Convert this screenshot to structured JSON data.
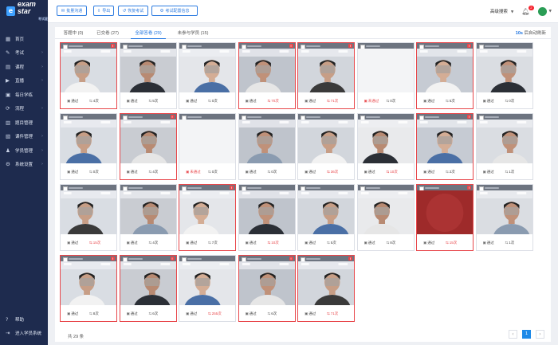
{
  "app": {
    "logo_text": "exam star",
    "logo_sub": "考试星"
  },
  "sidebar": {
    "items": [
      {
        "label": "首页",
        "icon": "grid-icon",
        "glyph": "▦",
        "chevron": false
      },
      {
        "label": "考试",
        "icon": "exam-icon",
        "glyph": "✎",
        "chevron": true
      },
      {
        "label": "课程",
        "icon": "course-icon",
        "glyph": "▤",
        "chevron": true
      },
      {
        "label": "直播",
        "icon": "live-icon",
        "glyph": "▶",
        "chevron": true
      },
      {
        "label": "每日学练",
        "icon": "calendar-icon",
        "glyph": "▣",
        "chevron": false
      },
      {
        "label": "流程",
        "icon": "flow-icon",
        "glyph": "⟳",
        "chevron": true
      },
      {
        "label": "题目管理",
        "icon": "question-icon",
        "glyph": "▥",
        "chevron": false
      },
      {
        "label": "课件管理",
        "icon": "courseware-icon",
        "glyph": "▧",
        "chevron": true
      },
      {
        "label": "学员管理",
        "icon": "student-icon",
        "glyph": "♟",
        "chevron": true
      },
      {
        "label": "系统设置",
        "icon": "gear-icon",
        "glyph": "⚙",
        "chevron": true
      }
    ],
    "bottom": [
      {
        "label": "帮助",
        "icon": "help-icon",
        "glyph": "?"
      },
      {
        "label": "进入学员系统",
        "icon": "enter-icon",
        "glyph": "⇥"
      }
    ]
  },
  "toolbar": {
    "buttons": [
      {
        "label": "批量沟通",
        "glyph": "✉",
        "name": "batch-message-button"
      },
      {
        "label": "导出",
        "glyph": "⇩",
        "name": "export-button"
      },
      {
        "label": "恢复考试",
        "glyph": "↺",
        "name": "resume-exam-button"
      },
      {
        "label": "考试配置信息",
        "glyph": "⚙",
        "name": "exam-config-button"
      }
    ]
  },
  "header": {
    "search_select": "高级搜索",
    "notif_count": "2"
  },
  "tabs": [
    {
      "label": "答题中 (0)",
      "active": false
    },
    {
      "label": "已交卷 (27)",
      "active": false
    },
    {
      "label": "全部答卷 (29)",
      "active": true
    },
    {
      "label": "未参与学员 (15)",
      "active": false
    }
  ],
  "refresh": {
    "seconds": "10s",
    "label": "后自动刷新"
  },
  "cards": [
    {
      "flag": true,
      "status": "通过",
      "count": "4次",
      "red": false,
      "cred": false
    },
    {
      "flag": false,
      "status": "通过",
      "count": "5次",
      "red": false,
      "cred": false
    },
    {
      "flag": false,
      "status": "通过",
      "count": "0次",
      "red": false,
      "cred": false
    },
    {
      "flag": true,
      "status": "通过",
      "count": "70次",
      "red": false,
      "cred": true
    },
    {
      "flag": true,
      "status": "通过",
      "count": "71次",
      "red": false,
      "cred": true
    },
    {
      "flag": false,
      "status": "未通过",
      "count": "0次",
      "red": true,
      "cred": false
    },
    {
      "flag": true,
      "status": "通过",
      "count": "5次",
      "red": false,
      "cred": false
    },
    {
      "flag": false,
      "status": "通过",
      "count": "0次",
      "red": false,
      "cred": false
    },
    {
      "flag": false,
      "status": "通过",
      "count": "0次",
      "red": false,
      "cred": false
    },
    {
      "flag": true,
      "status": "通过",
      "count": "4次",
      "red": false,
      "cred": false
    },
    {
      "flag": false,
      "status": "未通过",
      "count": "0次",
      "red": true,
      "cred": false
    },
    {
      "flag": false,
      "status": "通过",
      "count": "0次",
      "red": false,
      "cred": false
    },
    {
      "flag": false,
      "status": "通过",
      "count": "36次",
      "red": false,
      "cred": true
    },
    {
      "flag": false,
      "status": "通过",
      "count": "10次",
      "red": false,
      "cred": true
    },
    {
      "flag": true,
      "status": "通过",
      "count": "2次",
      "red": false,
      "cred": false
    },
    {
      "flag": false,
      "status": "通过",
      "count": "1次",
      "red": false,
      "cred": false
    },
    {
      "flag": false,
      "status": "通过",
      "count": "15次",
      "red": false,
      "cred": true
    },
    {
      "flag": false,
      "status": "通过",
      "count": "4次",
      "red": false,
      "cred": false
    },
    {
      "flag": true,
      "status": "通过",
      "count": "7次",
      "red": false,
      "cred": false
    },
    {
      "flag": false,
      "status": "通过",
      "count": "10次",
      "red": false,
      "cred": true
    },
    {
      "flag": false,
      "status": "通过",
      "count": "5次",
      "red": false,
      "cred": false
    },
    {
      "flag": false,
      "status": "通过",
      "count": "8次",
      "red": false,
      "cred": false
    },
    {
      "flag": true,
      "status": "通过",
      "count": "15次",
      "red": false,
      "cred": true
    },
    {
      "flag": false,
      "status": "通过",
      "count": "1次",
      "red": false,
      "cred": false
    },
    {
      "flag": true,
      "status": "通过",
      "count": "8次",
      "red": false,
      "cred": false
    },
    {
      "flag": true,
      "status": "通过",
      "count": "6次",
      "red": false,
      "cred": false
    },
    {
      "flag": false,
      "status": "通过",
      "count": "255次",
      "red": false,
      "cred": true
    },
    {
      "flag": true,
      "status": "通过",
      "count": "6次",
      "red": false,
      "cred": false
    },
    {
      "flag": true,
      "status": "通过",
      "count": "71次",
      "red": false,
      "cred": true
    }
  ],
  "footer": {
    "total": "共 29 条",
    "page": "1"
  },
  "colors": {
    "accent": "#1f74e0",
    "danger": "#e8474b",
    "sidebar": "#1e2b4e"
  }
}
